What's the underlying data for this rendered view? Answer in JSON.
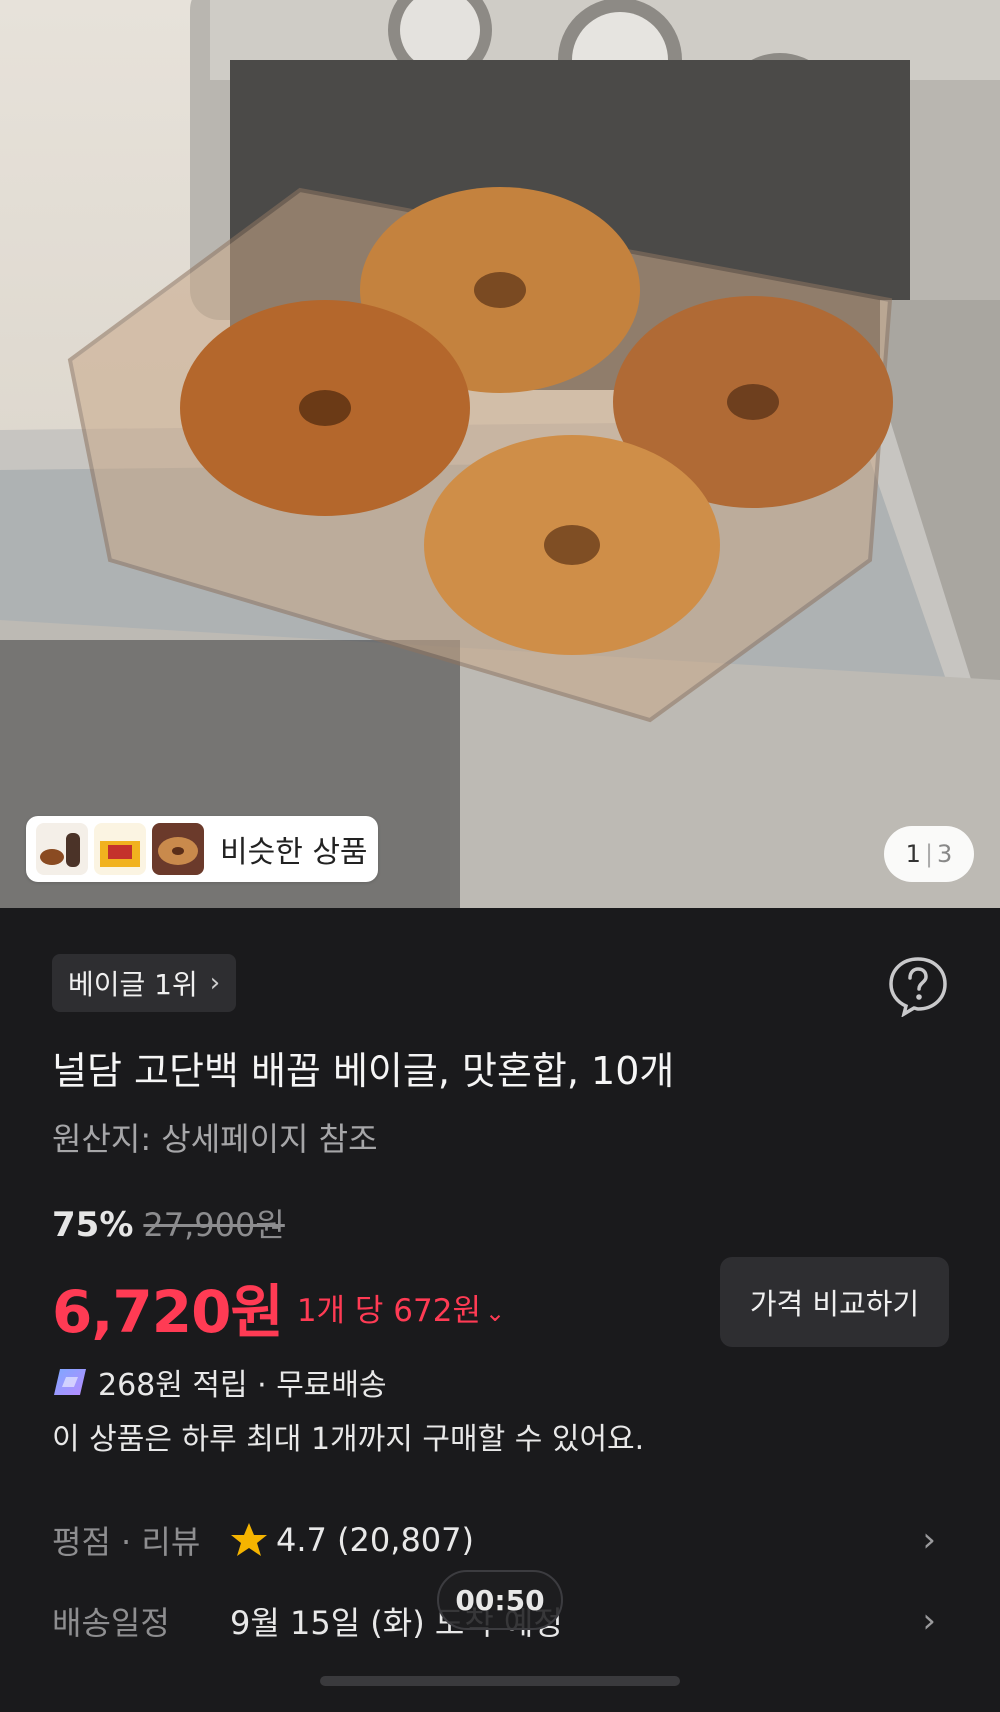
{
  "hero": {
    "similar_label": "비슷한 상품",
    "page_current": "1",
    "page_separator": "|",
    "page_total": "3"
  },
  "product": {
    "rank_label": "베이글 1위",
    "title": "널담 고단백 배꼽 베이글, 맛혼합, 10개",
    "origin": "원산지: 상세페이지 참조",
    "discount": "75%",
    "original_price": "27,900원",
    "price": "6,720원",
    "unit_price": "1개 당 672원",
    "compare_button": "가격 비교하기",
    "reward": "268원 적립 · 무료배송",
    "purchase_limit": "이 상품은 하루 최대 1개까지 구매할 수 있어요."
  },
  "rating": {
    "label": "평점 · 리뷰",
    "value": "4.7 (20,807)"
  },
  "delivery": {
    "label": "배송일정",
    "value": "9월 15일 (화) 도착 예정"
  },
  "timer": "00:50",
  "colors": {
    "accent_red": "#ff3b54",
    "background": "#1a1a1c",
    "chip_bg": "#2e2e31",
    "star": "#f5b400"
  },
  "icons": [
    "chevron-right-icon",
    "help-icon",
    "chevron-down-icon",
    "reward-coin-icon",
    "star-icon"
  ]
}
